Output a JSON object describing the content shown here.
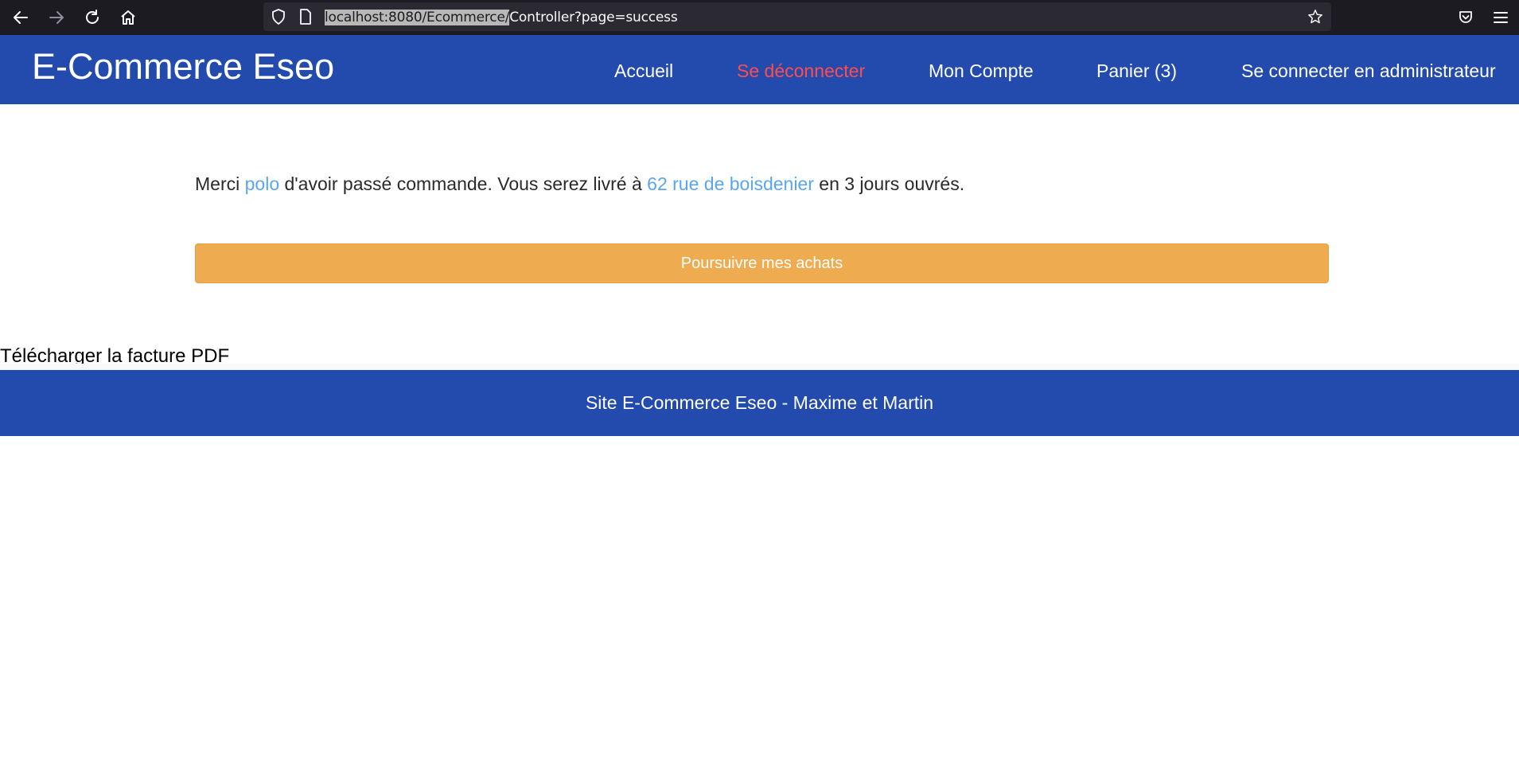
{
  "browser": {
    "url_selected": "localhost:8080/Ecommerce/",
    "url_rest": "Controller?page=success",
    "icons": [
      "back-arrow-icon",
      "forward-arrow-icon",
      "reload-icon",
      "home-icon",
      "shield-icon",
      "page-icon",
      "star-icon",
      "pocket-icon",
      "menu-icon"
    ]
  },
  "header": {
    "brand": "E-Commerce Eseo",
    "menu": {
      "home": "Accueil",
      "logout": "Se déconnecter",
      "account": "Mon Compte",
      "cart": "Panier (3)",
      "admin_login": "Se connecter en administrateur"
    }
  },
  "main": {
    "message_part1": "Merci ",
    "customer_name": "polo",
    "message_part2": " d'avoir passé commande. Vous serez livré à ",
    "address": "62 rue de boisdenier",
    "message_part3": " en 3 jours ouvrés.",
    "continue_label": "Poursuivre mes achats",
    "pdf_link": "Télécharger la facture PDF"
  },
  "footer": {
    "text": "Site E-Commerce Eseo - Maxime et Martin"
  },
  "colors": {
    "header_bg": "#234bae",
    "logout_text": "#ff4d4d",
    "highlight_text": "#5aa6ee",
    "button_bg": "#efab4f",
    "browser_bg": "#1c1b22"
  }
}
